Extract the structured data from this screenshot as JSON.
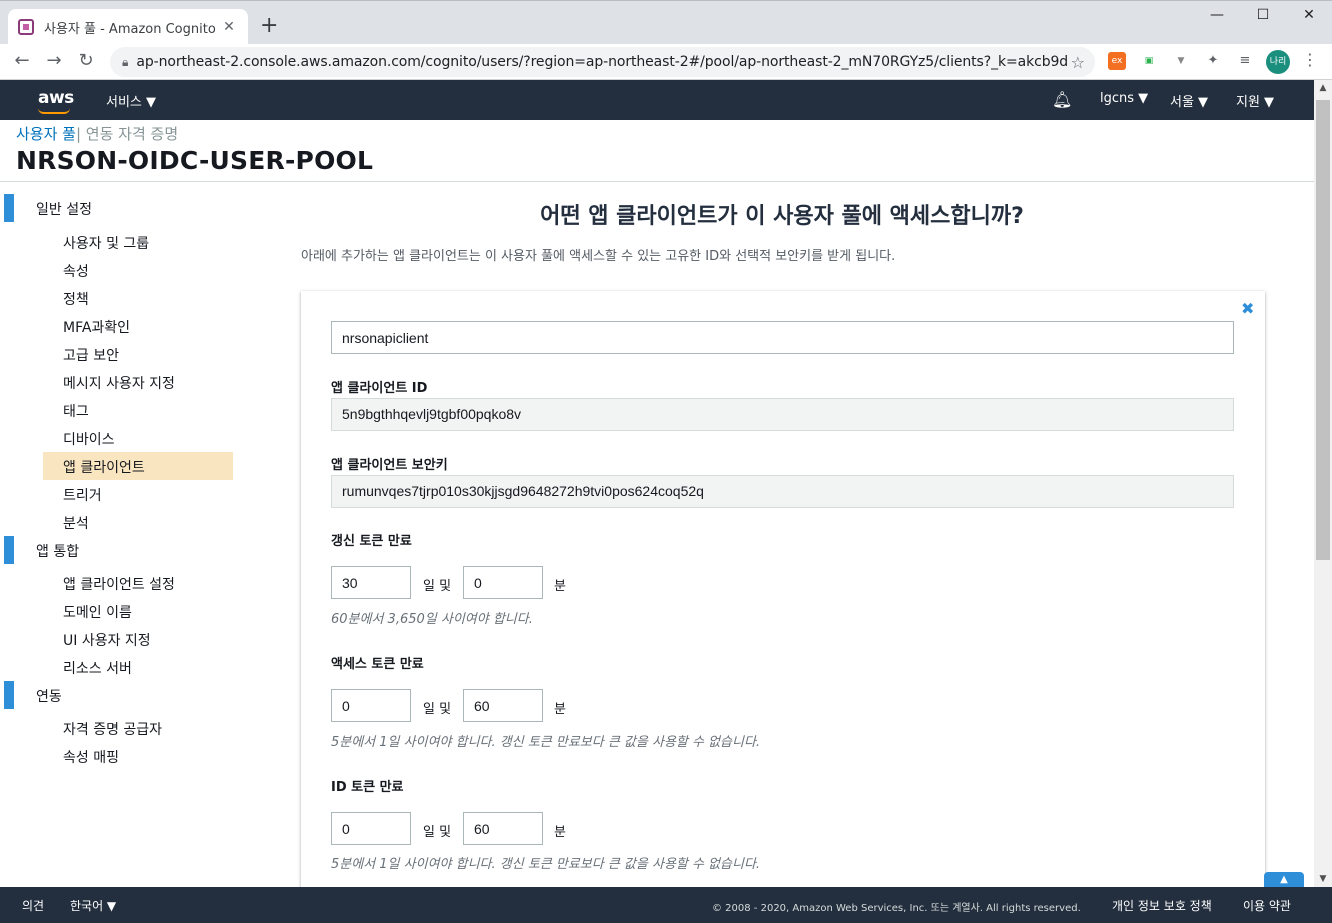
{
  "browser": {
    "tab_title": "사용자 풀 - Amazon Cognito",
    "tab_close": "✕",
    "new_tab": "+",
    "url": "ap-northeast-2.console.aws.amazon.com/cognito/users/?region=ap-northeast-2#/pool/ap-northeast-2_mN70RGYz5/clients?_k=akcb9d",
    "back": "←",
    "forward": "→",
    "reload": "↻",
    "profile_initials": "나리",
    "extensions": [
      "ex",
      "▣",
      "▼",
      "✦",
      "≡"
    ]
  },
  "aws_header": {
    "logo": "aws",
    "services": "서비스 ▼",
    "account": "lgcns ▼",
    "region": "서울 ▼",
    "support": "지원 ▼"
  },
  "page": {
    "crumb_link": "사용자 풀",
    "crumb_sep": "|",
    "crumb_other": " 연동 자격 증명",
    "pool_name": "NRSON-OIDC-USER-POOL"
  },
  "sidebar": {
    "sections": [
      {
        "label": "일반 설정",
        "items": [
          "사용자 및 그룹",
          "속성",
          "정책",
          "MFA과확인",
          "고급 보안",
          "메시지 사용자 지정",
          "태그",
          "디바이스",
          "앱 클라이언트",
          "트리거",
          "분석"
        ]
      },
      {
        "label": "앱 통합",
        "items": [
          "앱 클라이언트 설정",
          "도메인 이름",
          "UI 사용자 지정",
          "리소스 서버"
        ]
      },
      {
        "label": "연동",
        "items": [
          "자격 증명 공급자",
          "속성 매핑"
        ]
      }
    ],
    "active_item": "앱 클라이언트"
  },
  "main": {
    "title": "어떤 앱 클라이언트가 이 사용자 풀에 액세스합니까?",
    "description": "아래에 추가하는 앱 클라이언트는 이 사용자 풀에 액세스할 수 있는 고유한 ID와 선택적 보안키를 받게 됩니다.",
    "close_icon": "✖",
    "client_name": "nrsonapiclient",
    "client_id_label": "앱 클라이언트 ID",
    "client_id": "5n9bgthhqevlj9tgbf00pqko8v",
    "client_secret_label": "앱 클라이언트 보안키",
    "client_secret": "rumunvqes7tjrp010s30kjjsgd9648272h9tvi0pos624coq52q",
    "unit_day": "일 및",
    "unit_min": "분",
    "refresh": {
      "label": "갱신 토큰 만료",
      "days": "30",
      "minutes": "0",
      "hint": "60분에서 3,650일 사이여야 합니다."
    },
    "access": {
      "label": "액세스 토큰 만료",
      "days": "0",
      "minutes": "60",
      "hint": "5분에서 1일 사이여야 합니다. 갱신 토큰 만료보다 큰 값을 사용할 수 없습니다."
    },
    "id_token": {
      "label": "ID 토큰 만료",
      "days": "0",
      "minutes": "60",
      "hint": "5분에서 1일 사이여야 합니다. 갱신 토큰 만료보다 큰 값을 사용할 수 없습니다."
    }
  },
  "footer": {
    "feedback": "의견",
    "language": "한국어 ▼",
    "copyright": "© 2008 - 2020, Amazon Web Services, Inc. 또는 계열사. All rights reserved.",
    "privacy": "개인 정보 보호 정책",
    "terms": "이용 약관"
  }
}
